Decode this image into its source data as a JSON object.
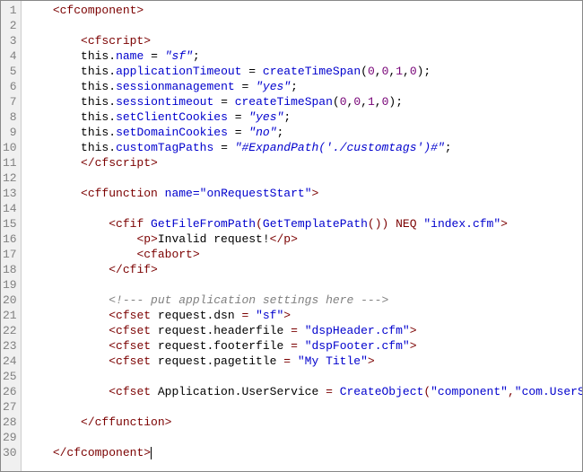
{
  "lines": [
    {
      "n": "1",
      "seg": [
        {
          "c": "tag",
          "t": "    <cfcomponent>"
        }
      ]
    },
    {
      "n": "2",
      "seg": [
        {
          "c": "",
          "t": ""
        }
      ]
    },
    {
      "n": "3",
      "seg": [
        {
          "c": "tag",
          "t": "        <cfscript>"
        }
      ]
    },
    {
      "n": "4",
      "seg": [
        {
          "c": "",
          "t": "        "
        },
        {
          "c": "kw",
          "t": "this"
        },
        {
          "c": "op",
          "t": "."
        },
        {
          "c": "prop",
          "t": "name"
        },
        {
          "c": "op",
          "t": " = "
        },
        {
          "c": "str",
          "t": "\"sf\""
        },
        {
          "c": "op",
          "t": ";"
        }
      ]
    },
    {
      "n": "5",
      "seg": [
        {
          "c": "",
          "t": "        "
        },
        {
          "c": "kw",
          "t": "this"
        },
        {
          "c": "op",
          "t": "."
        },
        {
          "c": "prop",
          "t": "applicationTimeout"
        },
        {
          "c": "op",
          "t": " = "
        },
        {
          "c": "func",
          "t": "createTimeSpan"
        },
        {
          "c": "op",
          "t": "("
        },
        {
          "c": "num",
          "t": "0"
        },
        {
          "c": "op",
          "t": ","
        },
        {
          "c": "num",
          "t": "0"
        },
        {
          "c": "op",
          "t": ","
        },
        {
          "c": "num",
          "t": "1"
        },
        {
          "c": "op",
          "t": ","
        },
        {
          "c": "num",
          "t": "0"
        },
        {
          "c": "op",
          "t": ");"
        }
      ]
    },
    {
      "n": "6",
      "seg": [
        {
          "c": "",
          "t": "        "
        },
        {
          "c": "kw",
          "t": "this"
        },
        {
          "c": "op",
          "t": "."
        },
        {
          "c": "prop",
          "t": "sessionmanagement"
        },
        {
          "c": "op",
          "t": " = "
        },
        {
          "c": "str",
          "t": "\"yes\""
        },
        {
          "c": "op",
          "t": ";"
        }
      ]
    },
    {
      "n": "7",
      "seg": [
        {
          "c": "",
          "t": "        "
        },
        {
          "c": "kw",
          "t": "this"
        },
        {
          "c": "op",
          "t": "."
        },
        {
          "c": "prop",
          "t": "sessiontimeout"
        },
        {
          "c": "op",
          "t": " = "
        },
        {
          "c": "func",
          "t": "createTimeSpan"
        },
        {
          "c": "op",
          "t": "("
        },
        {
          "c": "num",
          "t": "0"
        },
        {
          "c": "op",
          "t": ","
        },
        {
          "c": "num",
          "t": "0"
        },
        {
          "c": "op",
          "t": ","
        },
        {
          "c": "num",
          "t": "1"
        },
        {
          "c": "op",
          "t": ","
        },
        {
          "c": "num",
          "t": "0"
        },
        {
          "c": "op",
          "t": ");"
        }
      ]
    },
    {
      "n": "8",
      "seg": [
        {
          "c": "",
          "t": "        "
        },
        {
          "c": "kw",
          "t": "this"
        },
        {
          "c": "op",
          "t": "."
        },
        {
          "c": "prop",
          "t": "setClientCookies"
        },
        {
          "c": "op",
          "t": " = "
        },
        {
          "c": "str",
          "t": "\"yes\""
        },
        {
          "c": "op",
          "t": ";"
        }
      ]
    },
    {
      "n": "9",
      "seg": [
        {
          "c": "",
          "t": "        "
        },
        {
          "c": "kw",
          "t": "this"
        },
        {
          "c": "op",
          "t": "."
        },
        {
          "c": "prop",
          "t": "setDomainCookies"
        },
        {
          "c": "op",
          "t": " = "
        },
        {
          "c": "str",
          "t": "\"no\""
        },
        {
          "c": "op",
          "t": ";"
        }
      ]
    },
    {
      "n": "10",
      "seg": [
        {
          "c": "",
          "t": "        "
        },
        {
          "c": "kw",
          "t": "this"
        },
        {
          "c": "op",
          "t": "."
        },
        {
          "c": "prop",
          "t": "customTagPaths"
        },
        {
          "c": "op",
          "t": " = "
        },
        {
          "c": "str",
          "t": "\"#ExpandPath('./customtags')#\""
        },
        {
          "c": "op",
          "t": ";"
        }
      ]
    },
    {
      "n": "11",
      "seg": [
        {
          "c": "tag",
          "t": "        </cfscript>"
        }
      ]
    },
    {
      "n": "12",
      "seg": [
        {
          "c": "",
          "t": ""
        }
      ]
    },
    {
      "n": "13",
      "seg": [
        {
          "c": "",
          "t": "        "
        },
        {
          "c": "tag",
          "t": "<cffunction "
        },
        {
          "c": "attr",
          "t": "name="
        },
        {
          "c": "val",
          "t": "\"onRequestStart\""
        },
        {
          "c": "tag",
          "t": ">"
        }
      ]
    },
    {
      "n": "14",
      "seg": [
        {
          "c": "",
          "t": ""
        }
      ]
    },
    {
      "n": "15",
      "seg": [
        {
          "c": "",
          "t": "            "
        },
        {
          "c": "tag",
          "t": "<cfif "
        },
        {
          "c": "func",
          "t": "GetFileFromPath"
        },
        {
          "c": "tag",
          "t": "("
        },
        {
          "c": "func",
          "t": "GetTemplatePath"
        },
        {
          "c": "tag",
          "t": "()) NEQ "
        },
        {
          "c": "val",
          "t": "\"index.cfm\""
        },
        {
          "c": "tag",
          "t": ">"
        }
      ]
    },
    {
      "n": "16",
      "seg": [
        {
          "c": "",
          "t": "                "
        },
        {
          "c": "tag",
          "t": "<p>"
        },
        {
          "c": "ptxt",
          "t": "Invalid request!"
        },
        {
          "c": "tag",
          "t": "</p>"
        }
      ]
    },
    {
      "n": "17",
      "seg": [
        {
          "c": "",
          "t": "                "
        },
        {
          "c": "tag",
          "t": "<cfabort>"
        }
      ]
    },
    {
      "n": "18",
      "seg": [
        {
          "c": "",
          "t": "            "
        },
        {
          "c": "tag",
          "t": "</cfif>"
        }
      ]
    },
    {
      "n": "19",
      "seg": [
        {
          "c": "",
          "t": ""
        }
      ]
    },
    {
      "n": "20",
      "seg": [
        {
          "c": "",
          "t": "            "
        },
        {
          "c": "cmt",
          "t": "<!--- put application settings here --->"
        }
      ]
    },
    {
      "n": "21",
      "seg": [
        {
          "c": "",
          "t": "            "
        },
        {
          "c": "tag",
          "t": "<cfset "
        },
        {
          "c": "txt",
          "t": "request.dsn"
        },
        {
          "c": "tag",
          "t": " = "
        },
        {
          "c": "val",
          "t": "\"sf\""
        },
        {
          "c": "tag",
          "t": ">"
        }
      ]
    },
    {
      "n": "22",
      "seg": [
        {
          "c": "",
          "t": "            "
        },
        {
          "c": "tag",
          "t": "<cfset "
        },
        {
          "c": "txt",
          "t": "request.headerfile"
        },
        {
          "c": "tag",
          "t": " = "
        },
        {
          "c": "val",
          "t": "\"dspHeader.cfm\""
        },
        {
          "c": "tag",
          "t": ">"
        }
      ]
    },
    {
      "n": "23",
      "seg": [
        {
          "c": "",
          "t": "            "
        },
        {
          "c": "tag",
          "t": "<cfset "
        },
        {
          "c": "txt",
          "t": "request.footerfile"
        },
        {
          "c": "tag",
          "t": " = "
        },
        {
          "c": "val",
          "t": "\"dspFooter.cfm\""
        },
        {
          "c": "tag",
          "t": ">"
        }
      ]
    },
    {
      "n": "24",
      "seg": [
        {
          "c": "",
          "t": "            "
        },
        {
          "c": "tag",
          "t": "<cfset "
        },
        {
          "c": "txt",
          "t": "request.pagetitle"
        },
        {
          "c": "tag",
          "t": " = "
        },
        {
          "c": "val",
          "t": "\"My Title\""
        },
        {
          "c": "tag",
          "t": ">"
        }
      ]
    },
    {
      "n": "25",
      "seg": [
        {
          "c": "",
          "t": ""
        }
      ]
    },
    {
      "n": "26",
      "seg": [
        {
          "c": "",
          "t": "            "
        },
        {
          "c": "tag",
          "t": "<cfset "
        },
        {
          "c": "txt",
          "t": "Application.UserService"
        },
        {
          "c": "tag",
          "t": " = "
        },
        {
          "c": "func",
          "t": "CreateObject"
        },
        {
          "c": "tag",
          "t": "("
        },
        {
          "c": "val",
          "t": "\"component\""
        },
        {
          "c": "tag",
          "t": ","
        },
        {
          "c": "val",
          "t": "\"com.UserService\""
        },
        {
          "c": "tag",
          "t": ")>"
        }
      ]
    },
    {
      "n": "27",
      "seg": [
        {
          "c": "",
          "t": ""
        }
      ]
    },
    {
      "n": "28",
      "seg": [
        {
          "c": "",
          "t": "        "
        },
        {
          "c": "tag",
          "t": "</cffunction>"
        }
      ]
    },
    {
      "n": "29",
      "seg": [
        {
          "c": "",
          "t": ""
        }
      ]
    },
    {
      "n": "30",
      "seg": [
        {
          "c": "",
          "t": "    "
        },
        {
          "c": "tag",
          "t": "</cfcomponent>"
        },
        {
          "c": "caret",
          "t": ""
        }
      ]
    }
  ]
}
